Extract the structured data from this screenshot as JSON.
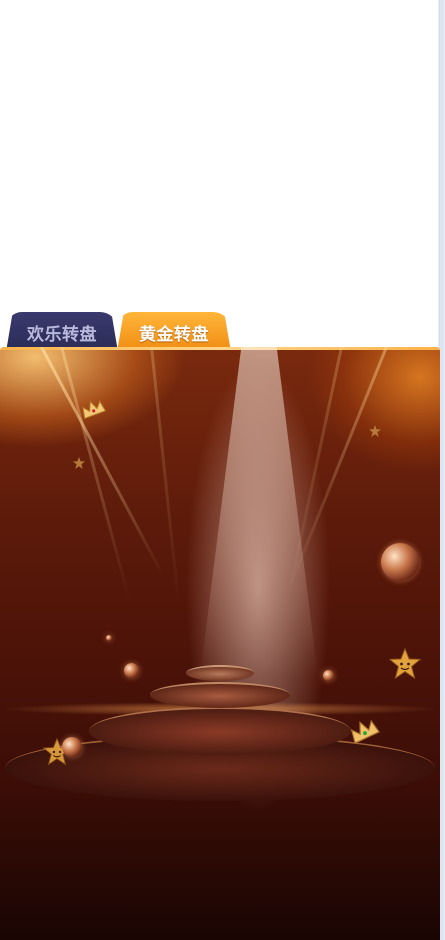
{
  "tabs": [
    {
      "label": "欢乐转盘",
      "state": "inactive"
    },
    {
      "label": "黄金转盘",
      "state": "active"
    }
  ],
  "colors": {
    "tab_inactive": "#2b2b55",
    "tab_active": "#f59a1a",
    "stage_dark": "#3a0d06",
    "accent_glow": "#ffb24a"
  },
  "stage": {
    "decorations": [
      "crown-icon",
      "crown-icon",
      "star-icon",
      "star-icon",
      "star-smile-icon",
      "star-smile-icon",
      "disco-ball-icon",
      "disco-ball-icon",
      "disco-ball-icon",
      "disco-ball-icon",
      "disco-ball-icon"
    ]
  }
}
